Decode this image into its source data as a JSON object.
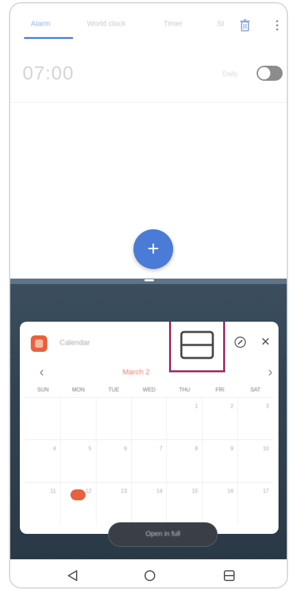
{
  "clock": {
    "tabs": [
      {
        "label": "Alarm"
      },
      {
        "label": "World clock"
      },
      {
        "label": "Timer"
      },
      {
        "label": "St"
      }
    ],
    "alarm": {
      "time": "07:00",
      "label": "Daily"
    }
  },
  "popup": {
    "app_title": "Calendar",
    "month": "March 2",
    "weekdays": [
      "SUN",
      "MON",
      "TUE",
      "WED",
      "THU",
      "FRI",
      "SAT"
    ],
    "weeks": [
      [
        "",
        "",
        "",
        "",
        "1",
        "2",
        "3"
      ],
      [
        "4",
        "5",
        "6",
        "7",
        "8",
        "9",
        "10"
      ],
      [
        "11",
        "12",
        "13",
        "14",
        "15",
        "16",
        "17"
      ]
    ],
    "open_button_label": "Open in full"
  },
  "colors": {
    "accent": "#4a7bd6",
    "calendar_red": "#e8613f",
    "highlight_box": "#a1336a"
  }
}
